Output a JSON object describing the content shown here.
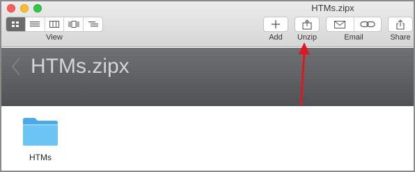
{
  "window": {
    "title": "HTMs.zipx"
  },
  "toolbar": {
    "view_label": "View",
    "view_modes": [
      {
        "name": "icon-view",
        "icon": "grid-icon",
        "active": true
      },
      {
        "name": "list-view",
        "icon": "list-icon",
        "active": false
      },
      {
        "name": "column-view",
        "icon": "columns-icon",
        "active": false
      },
      {
        "name": "coverflow-view",
        "icon": "coverflow-icon",
        "active": false
      },
      {
        "name": "tree-view",
        "icon": "tree-list-icon",
        "active": false
      }
    ],
    "add_label": "Add",
    "unzip_label": "Unzip",
    "email_label": "Email",
    "share_label": "Share"
  },
  "pathbar": {
    "title": "HTMs.zipx"
  },
  "content": {
    "items": [
      {
        "label": "HTMs",
        "icon": "folder-icon"
      }
    ]
  },
  "colors": {
    "annotation_arrow": "#e0171f",
    "pathbar_bg": "#5d5e62",
    "folder": "#6cc4f5",
    "active_segment": "#6b6b6b"
  }
}
